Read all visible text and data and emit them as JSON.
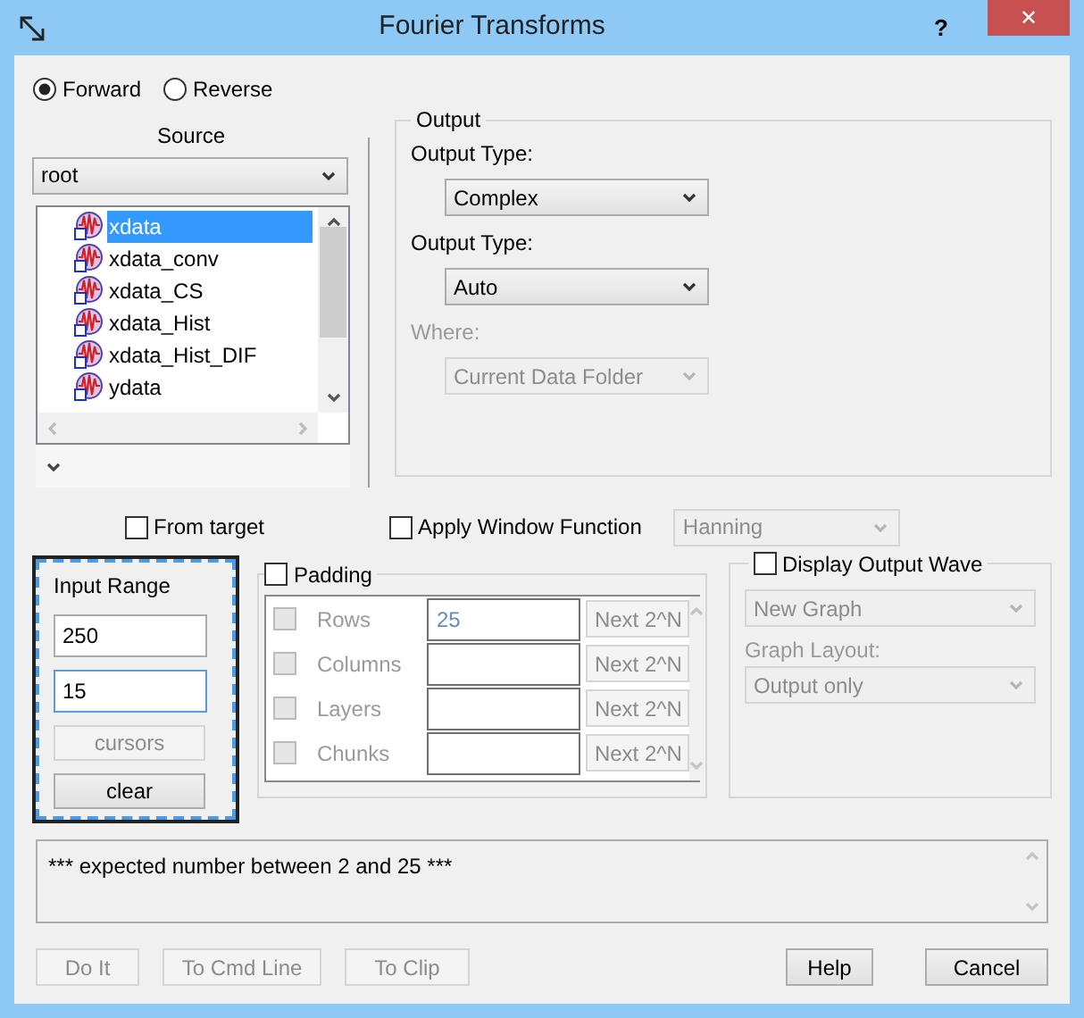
{
  "window": {
    "title": "Fourier Transforms",
    "help": "?",
    "close": "✕"
  },
  "direction": [
    {
      "label": "Forward",
      "selected": true
    },
    {
      "label": "Reverse",
      "selected": false
    }
  ],
  "source": {
    "label": "Source",
    "folder": "root",
    "items": [
      {
        "label": "xdata",
        "selected": true
      },
      {
        "label": "xdata_conv",
        "selected": false
      },
      {
        "label": "xdata_CS",
        "selected": false
      },
      {
        "label": "xdata_Hist",
        "selected": false
      },
      {
        "label": "xdata_Hist_DIF",
        "selected": false
      },
      {
        "label": "ydata",
        "selected": false
      }
    ]
  },
  "output": {
    "title": "Output",
    "fields": [
      {
        "label": "Output Type:",
        "value": "Complex",
        "disabled": false
      },
      {
        "label": "Output Type:",
        "value": "Auto",
        "disabled": false
      },
      {
        "label": "Where:",
        "value": "Current Data Folder",
        "disabled": true
      }
    ]
  },
  "from_target": {
    "label": "From target",
    "checked": false
  },
  "window_function": {
    "label": "Apply Window Function",
    "checked": false,
    "value": "Hanning",
    "disabled": true
  },
  "input_range": {
    "title": "Input Range",
    "fields": [
      {
        "value": "250",
        "focused": false
      },
      {
        "value": "15",
        "focused": true
      }
    ],
    "buttons": [
      {
        "label": "cursors",
        "disabled": true
      },
      {
        "label": "clear",
        "disabled": false
      }
    ]
  },
  "padding": {
    "label": "Padding",
    "checked": false,
    "rows": [
      {
        "label": "Rows",
        "value": "25",
        "button": "Next 2^N",
        "checked": false
      },
      {
        "label": "Columns",
        "value": "",
        "button": "Next 2^N",
        "checked": false
      },
      {
        "label": "Layers",
        "value": "",
        "button": "Next 2^N",
        "checked": false
      },
      {
        "label": "Chunks",
        "value": "",
        "button": "Next 2^N",
        "checked": false
      }
    ]
  },
  "display_output": {
    "label": "Display Output Wave",
    "checked": false,
    "graph": "New Graph",
    "layout_label": "Graph Layout:",
    "layout": "Output only"
  },
  "message": "*** expected number between 2 and 25 ***",
  "left_buttons": [
    {
      "label": "Do It",
      "disabled": true
    },
    {
      "label": "To Cmd Line",
      "disabled": true
    },
    {
      "label": "To Clip",
      "disabled": true
    }
  ],
  "right_buttons": [
    {
      "label": "Help",
      "disabled": false
    },
    {
      "label": "Cancel",
      "disabled": false
    }
  ]
}
